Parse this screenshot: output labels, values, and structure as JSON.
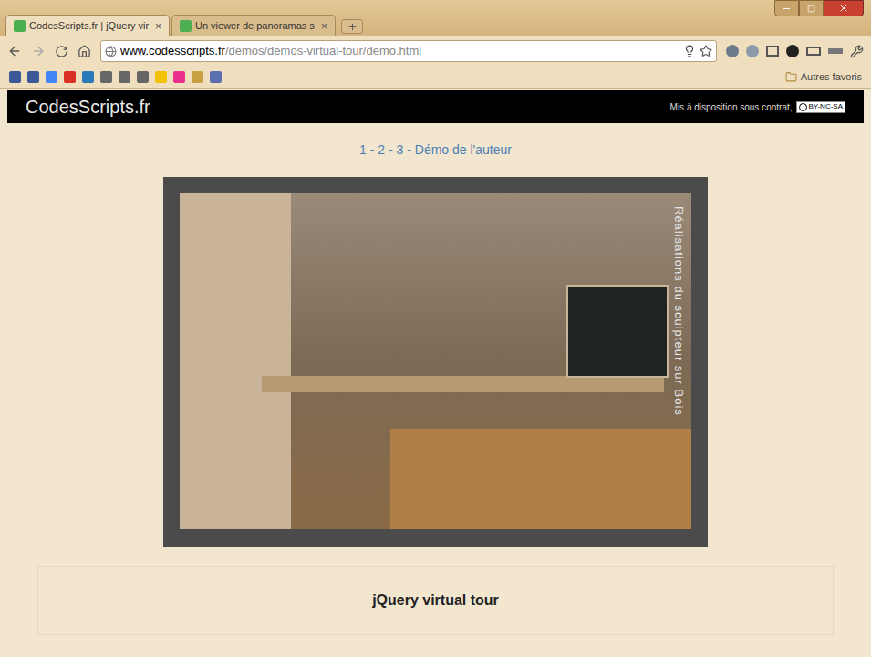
{
  "tabs": [
    {
      "label": "CodesScripts.fr | jQuery vir",
      "close": "×",
      "selected": true
    },
    {
      "label": "Un viewer de panoramas s",
      "close": "×",
      "selected": false
    }
  ],
  "address_bar": {
    "host": "www.codesscripts.fr",
    "path": "/demos/demos-virtual-tour/demo.html"
  },
  "bookmarks": {
    "items": [
      {
        "color": "#3b5998"
      },
      {
        "color": "#3b5998"
      },
      {
        "color": "#4285f4"
      },
      {
        "color": "#d93025"
      },
      {
        "color": "#2a7ab8"
      },
      {
        "color": "#666666"
      },
      {
        "color": "#666666"
      },
      {
        "color": "#666666"
      },
      {
        "color": "#f2c200"
      },
      {
        "color": "#e8308c"
      },
      {
        "color": "#c8a040"
      },
      {
        "color": "#5a6fb0"
      }
    ],
    "other": "Autres favoris"
  },
  "page": {
    "site_title": "CodesScripts.fr",
    "license_text": "Mis à disposition sous contrat,",
    "license_badge": "BY-NC-SA",
    "nav": [
      {
        "label": "1"
      },
      {
        "label": "2"
      },
      {
        "label": "3"
      },
      {
        "label": "Démo de l'auteur"
      }
    ],
    "separator": " - ",
    "viewer": {
      "caption": "Réalisations du sculpteur sur Bois"
    },
    "title": "jQuery virtual tour"
  }
}
